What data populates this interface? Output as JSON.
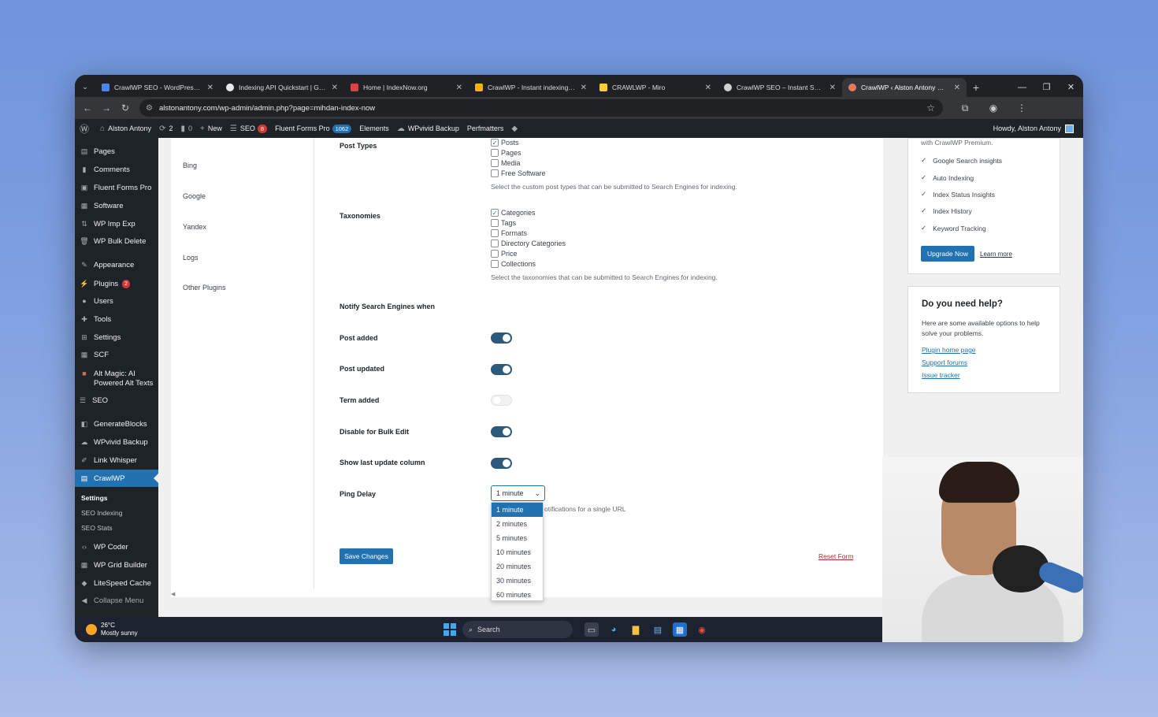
{
  "browser": {
    "tabs": [
      {
        "label": "CrawlWP SEO - WordPress Inst",
        "color": "#4a86e8"
      },
      {
        "label": "Indexing API Quickstart | Goog",
        "color": "#e8eaed"
      },
      {
        "label": "Home | IndexNow.org",
        "color": "#e0433f"
      },
      {
        "label": "CrawlWP - Instant indexing for",
        "color": "#f4b400"
      },
      {
        "label": "CRAWLWP - Miro",
        "color": "#ffd02f"
      },
      {
        "label": "CrawlWP SEO – Instant Search",
        "color": "#cfcfcf"
      },
      {
        "label": "CrawlWP ‹ Alston Antony — W",
        "color": "#e8785a"
      }
    ],
    "url": "alstonantony.com/wp-admin/admin.php?page=mihdan-index-now"
  },
  "adminbar": {
    "site": "Alston Antony",
    "updates": "2",
    "comments": "0",
    "new": "New",
    "seo": "SEO",
    "seo_badge": "8",
    "fluent": "Fluent Forms Pro",
    "fluent_badge": "1062",
    "elements": "Elements",
    "wpvivid": "WPvivid Backup",
    "perfmatters": "Perfmatters",
    "howdy": "Howdy, Alston Antony"
  },
  "sidebar": {
    "items": [
      "Pages",
      "Comments",
      "Fluent Forms Pro",
      "Software",
      "WP Imp Exp",
      "WP Bulk Delete",
      "Appearance",
      "Plugins",
      "Users",
      "Tools",
      "Settings",
      "SCF",
      "Alt Magic: AI",
      "Powered Alt Texts",
      "SEO",
      "GenerateBlocks",
      "WPvivid Backup",
      "Link Whisper",
      "CrawlWP",
      "WP Coder",
      "WP Grid Builder",
      "LiteSpeed Cache",
      "Collapse Menu"
    ],
    "plugins_badge": "2",
    "sub": [
      "Settings",
      "SEO Indexing",
      "SEO Stats"
    ]
  },
  "sidenav": [
    "Bing",
    "Google",
    "Yandex",
    "Logs",
    "Other Plugins"
  ],
  "form": {
    "post_types_label": "Post Types",
    "post_types": [
      {
        "label": "Posts",
        "checked": true
      },
      {
        "label": "Pages",
        "checked": false
      },
      {
        "label": "Media",
        "checked": false
      },
      {
        "label": "Free Software",
        "checked": false
      }
    ],
    "post_types_desc": "Select the custom post types that can be submitted to Search Engines for indexing.",
    "taxonomies_label": "Taxonomies",
    "taxonomies": [
      {
        "label": "Categories",
        "checked": true
      },
      {
        "label": "Tags",
        "checked": false
      },
      {
        "label": "Formats",
        "checked": false
      },
      {
        "label": "Directory Categories",
        "checked": false
      },
      {
        "label": "Price",
        "checked": false
      },
      {
        "label": "Collections",
        "checked": false
      }
    ],
    "taxonomies_desc": "Select the taxonomies that can be submitted to Search Engines for indexing.",
    "notify_label": "Notify Search Engines when",
    "toggles": [
      {
        "label": "Post added",
        "on": true
      },
      {
        "label": "Post updated",
        "on": true
      },
      {
        "label": "Term added",
        "on": false
      },
      {
        "label": "Disable for Bulk Edit",
        "on": true
      },
      {
        "label": "Show last update column",
        "on": true
      }
    ],
    "ping_label": "Ping Delay",
    "ping_value": "1 minute",
    "ping_desc_visible": "otifications for a single URL",
    "ping_options": [
      "1 minute",
      "2 minutes",
      "5 minutes",
      "10 minutes",
      "20 minutes",
      "30 minutes",
      "60 minutes"
    ],
    "save": "Save Changes",
    "reset": "Reset Form"
  },
  "premium": {
    "intro": "with CrawlWP Premium.",
    "features": [
      "Google Search insights",
      "Auto Indexing",
      "Index Status Insights",
      "Index History",
      "Keyword Tracking"
    ],
    "upgrade": "Upgrade Now",
    "learn": "Learn more"
  },
  "help": {
    "title": "Do you need help?",
    "text": "Here are some available options to help solve your problems.",
    "links": [
      "Plugin home page",
      "Support forums",
      "Issue tracker"
    ]
  },
  "taskbar": {
    "temp": "26°C",
    "weather": "Mostly sunny",
    "search": "Search"
  }
}
